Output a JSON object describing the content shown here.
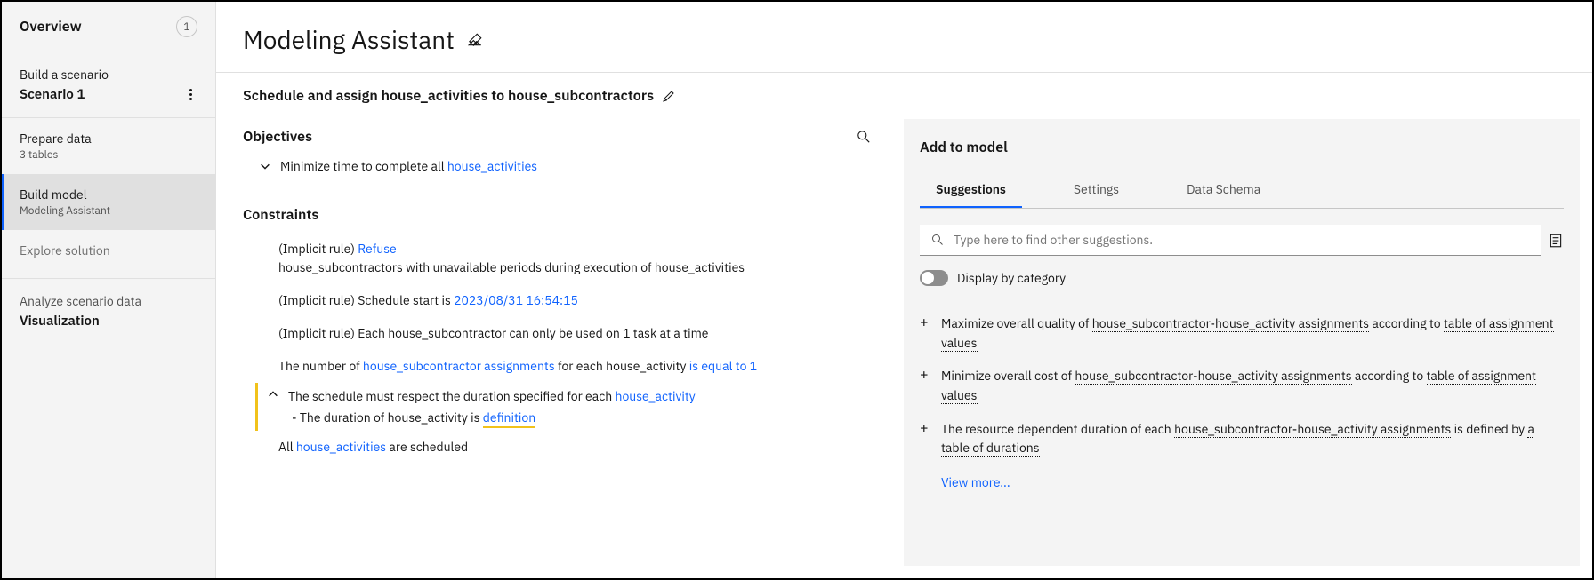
{
  "sidebar": {
    "overview": "Overview",
    "overview_badge": "1",
    "build_scenario_label": "Build a scenario",
    "scenario_name": "Scenario 1",
    "prepare": {
      "title": "Prepare data",
      "sub": "3 tables"
    },
    "build": {
      "title": "Build model",
      "sub": "Modeling Assistant"
    },
    "explore": {
      "title": "Explore solution"
    },
    "analyze_label": "Analyze scenario data",
    "visualization": "Visualization"
  },
  "header": {
    "title": "Modeling Assistant",
    "subtitle": "Schedule and assign house_activities to house_subcontractors"
  },
  "objectives": {
    "heading": "Objectives",
    "item_prefix": "Minimize time to complete all ",
    "item_link": "house_activities"
  },
  "constraints": {
    "heading": "Constraints",
    "c1_prefix": "(Implicit rule) ",
    "c1_link": "Refuse",
    "c1_line2": "house_subcontractors with unavailable periods during execution of house_activities",
    "c2_prefix": "(Implicit rule) Schedule start is ",
    "c2_link": "2023/08/31 16:54:15",
    "c3": "(Implicit rule) Each house_subcontractor can only be used on 1 task at a time",
    "c4_prefix": "The number of ",
    "c4_link": "house_subcontractor assignments",
    "c4_mid": " for each house_activity ",
    "c4_link2": "is equal to",
    "c4_val": "  1",
    "c5_prefix": "The schedule must respect the duration specified for each ",
    "c5_link": "house_activity",
    "c5_sub_prefix": "- The duration of house_activity is ",
    "c5_sub_link": "definition ",
    "c6_prefix": "All ",
    "c6_link": "house_activities",
    "c6_suffix": " are scheduled"
  },
  "right": {
    "heading": "Add to model",
    "tabs": [
      "Suggestions",
      "Settings",
      "Data Schema"
    ],
    "search_placeholder": "Type here to find other suggestions.",
    "toggle_label": "Display by category",
    "s1_a": "Maximize overall quality of ",
    "s1_u1": "house_subcontractor-house_activity assignments",
    "s1_b": " according to ",
    "s1_u2": "table of assignment values",
    "s2_a": "Minimize overall cost of ",
    "s2_u1": "house_subcontractor-house_activity assignments",
    "s2_b": " according to ",
    "s2_u2": "table of assignment values",
    "s3_a": "The resource dependent duration of each ",
    "s3_u1": "house_subcontractor-house_activity assignments",
    "s3_b": " is defined by ",
    "s3_u2": "a table of durations",
    "view_more": "View more..."
  }
}
